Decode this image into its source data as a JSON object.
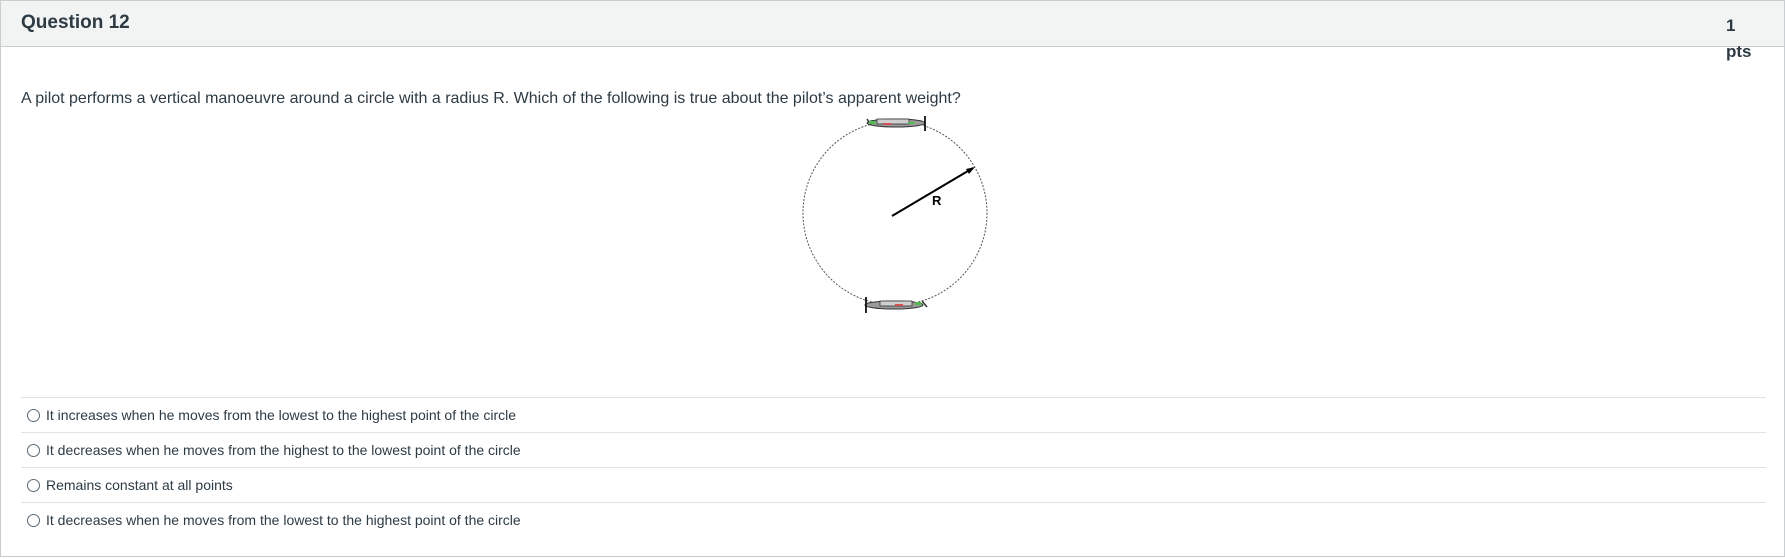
{
  "question": {
    "title": "Question 12",
    "points_value": "1",
    "points_unit": "pts",
    "text": "A pilot performs a vertical manoeuvre around a circle with a radius R. Which of the following is true about the pilot’s apparent weight?"
  },
  "diagram": {
    "radius_label": "R"
  },
  "answers": [
    {
      "label": "It increases when he moves from the lowest to the highest point of the circle"
    },
    {
      "label": "It decreases when he moves from the highest to the lowest point of the circle"
    },
    {
      "label": "Remains constant at all points"
    },
    {
      "label": "It decreases when he moves from the lowest to the highest point of the circle"
    }
  ],
  "colors": {
    "header_background": "#f2f4f4",
    "border": "#c7cdd1",
    "text": "#2d3b45"
  }
}
